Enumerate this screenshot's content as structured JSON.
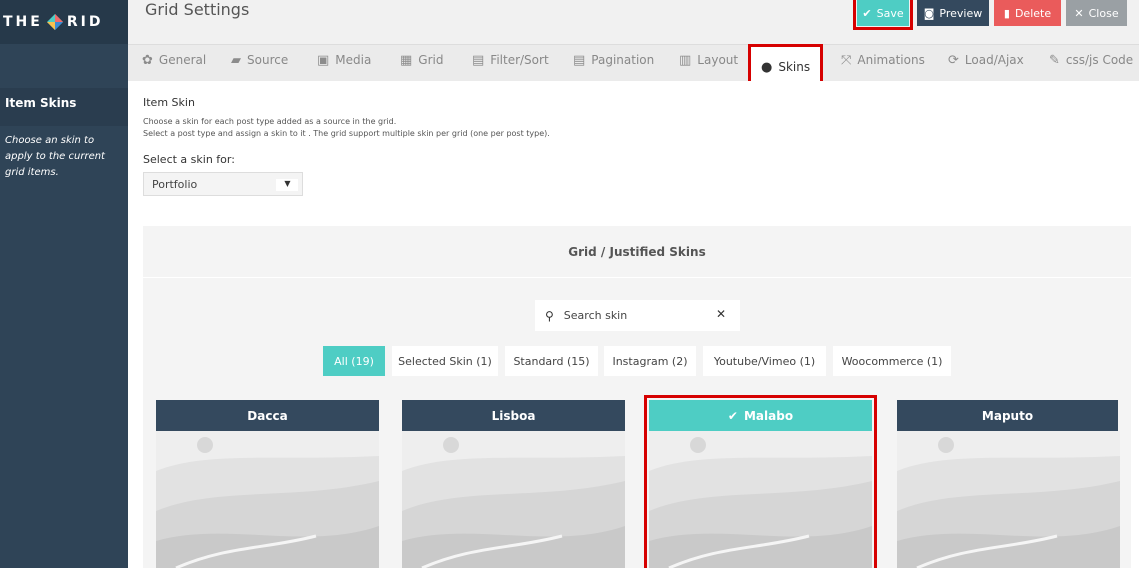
{
  "brand": {
    "logo_left": "THE",
    "logo_right": "RID"
  },
  "header": {
    "title": "Grid Settings",
    "buttons": {
      "save": "Save",
      "preview": "Preview",
      "delete": "Delete",
      "close": "Close"
    }
  },
  "tabs": [
    {
      "label": "General",
      "icon": "gear-icon"
    },
    {
      "label": "Source",
      "icon": "folder-icon"
    },
    {
      "label": "Media",
      "icon": "image-icon"
    },
    {
      "label": "Grid",
      "icon": "grid-icon"
    },
    {
      "label": "Filter/Sort",
      "icon": "filter-icon"
    },
    {
      "label": "Pagination",
      "icon": "pagination-icon"
    },
    {
      "label": "Layout",
      "icon": "layout-icon"
    },
    {
      "label": "Skins",
      "icon": "palette-icon"
    },
    {
      "label": "Animations",
      "icon": "animations-icon"
    },
    {
      "label": "Load/Ajax",
      "icon": "refresh-icon"
    },
    {
      "label": "css/js Code",
      "icon": "wrench-icon"
    }
  ],
  "sidebar": {
    "title": "Item Skins",
    "description": "Choose an skin to apply to the current grid items."
  },
  "item_skin": {
    "title": "Item Skin",
    "description_1": "Choose a skin for each post type added as a source in the grid.",
    "description_2": "Select a post type and assign a skin to it . The grid support multiple skin per grid (one per post type).",
    "select_label": "Select a skin for:",
    "selected_value": "Portfolio"
  },
  "skins_panel": {
    "title": "Grid / Justified Skins",
    "search_placeholder": "Search skin",
    "filters": [
      {
        "label": "All (19)",
        "active": true
      },
      {
        "label": "Selected Skin (1)",
        "active": false
      },
      {
        "label": "Standard (15)",
        "active": false
      },
      {
        "label": "Instagram (2)",
        "active": false
      },
      {
        "label": "Youtube/Vimeo (1)",
        "active": false
      },
      {
        "label": "Woocommerce (1)",
        "active": false
      }
    ],
    "cards": [
      {
        "name": "Dacca",
        "selected": false
      },
      {
        "name": "Lisboa",
        "selected": false
      },
      {
        "name": "Malabo",
        "selected": true
      },
      {
        "name": "Maputo",
        "selected": false
      }
    ]
  },
  "colors": {
    "accent": "#4ecdc4",
    "dark": "#34495e",
    "danger": "#ea5b5b",
    "highlight": "#d60000"
  }
}
